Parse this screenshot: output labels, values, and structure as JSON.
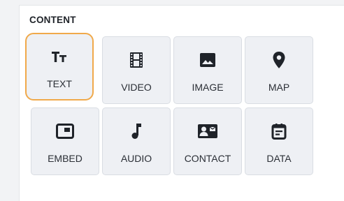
{
  "section": {
    "title": "CONTENT"
  },
  "tiles": [
    {
      "label": "TEXT",
      "icon": "text-format-icon",
      "selected": true
    },
    {
      "label": "VIDEO",
      "icon": "film-icon"
    },
    {
      "label": "IMAGE",
      "icon": "image-icon"
    },
    {
      "label": "MAP",
      "icon": "map-pin-icon"
    },
    {
      "label": "EMBED",
      "icon": "embed-icon"
    },
    {
      "label": "AUDIO",
      "icon": "music-note-icon"
    },
    {
      "label": "CONTACT",
      "icon": "contact-card-icon"
    },
    {
      "label": "DATA",
      "icon": "calendar-data-icon"
    }
  ],
  "colors": {
    "selected_outline": "#f0a94a",
    "tile_bg": "#eef0f4",
    "icon": "#1f2329"
  }
}
